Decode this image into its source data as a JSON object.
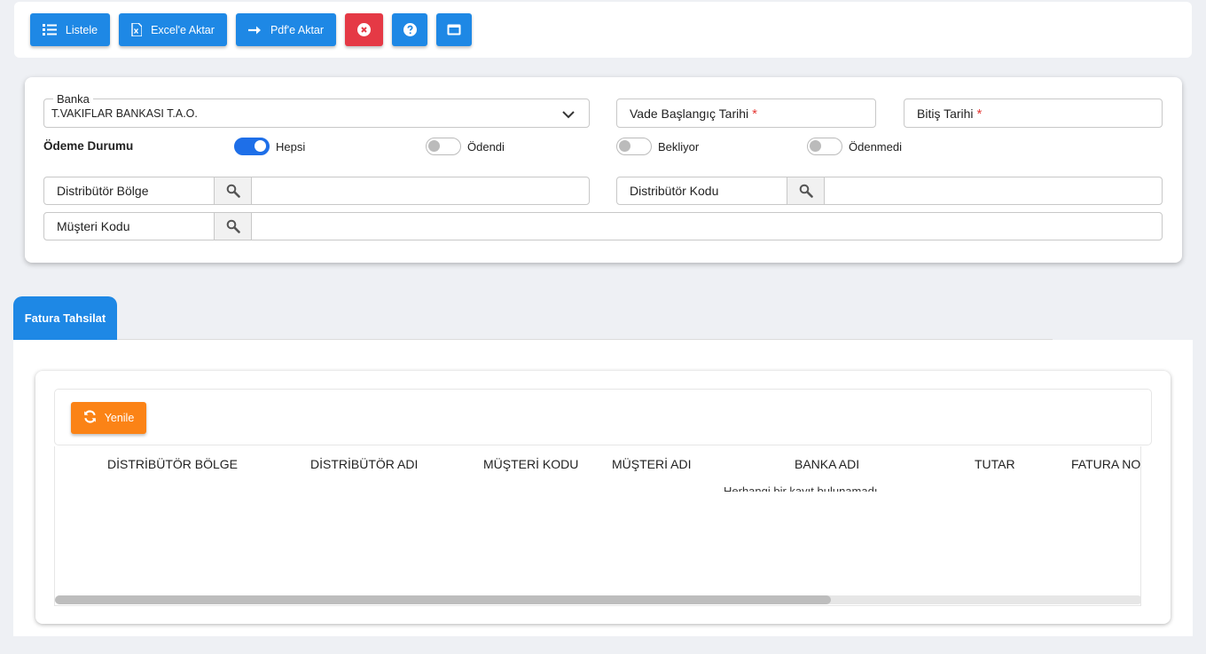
{
  "toolbar": {
    "list_label": "Listele",
    "excel_label": "Excel'e Aktar",
    "pdf_label": "Pdf'e Aktar"
  },
  "filters": {
    "bank": {
      "legend": "Banka",
      "value": "T.VAKIFLAR BANKASI T.A.O."
    },
    "start_date": {
      "label": "Vade Başlangıç Tarihi",
      "required": "*"
    },
    "end_date": {
      "label": "Bitiş Tarihi",
      "required": "*"
    },
    "payment_status": {
      "label": "Ödeme Durumu",
      "options": [
        {
          "label": "Hepsi",
          "on": true
        },
        {
          "label": "Ödendi",
          "on": false
        },
        {
          "label": "Bekliyor",
          "on": false
        },
        {
          "label": "Ödenmedi",
          "on": false
        }
      ]
    },
    "distributor_region": {
      "label": "Distribütör Bölge",
      "value": ""
    },
    "distributor_code": {
      "label": "Distribütör Kodu",
      "value": ""
    },
    "customer_code": {
      "label": "Müşteri Kodu",
      "value": ""
    }
  },
  "tabs": [
    {
      "label": "Fatura Tahsilat",
      "active": true
    }
  ],
  "grid": {
    "refresh_label": "Yenile",
    "columns": [
      "DİSTRİBÜTÖR BÖLGE",
      "DİSTRİBÜTÖR ADI",
      "MÜŞTERİ KODU",
      "MÜŞTERİ ADI",
      "BANKA ADI",
      "TUTAR",
      "FATURA NO"
    ],
    "empty_message": "Herhangi bir kayıt bulunamadı",
    "scroll_fraction": 0.714
  },
  "colors": {
    "primary": "#1e88e5",
    "danger": "#e53945",
    "orange": "#fb8316",
    "toggle_on": "#1e6fe8"
  }
}
